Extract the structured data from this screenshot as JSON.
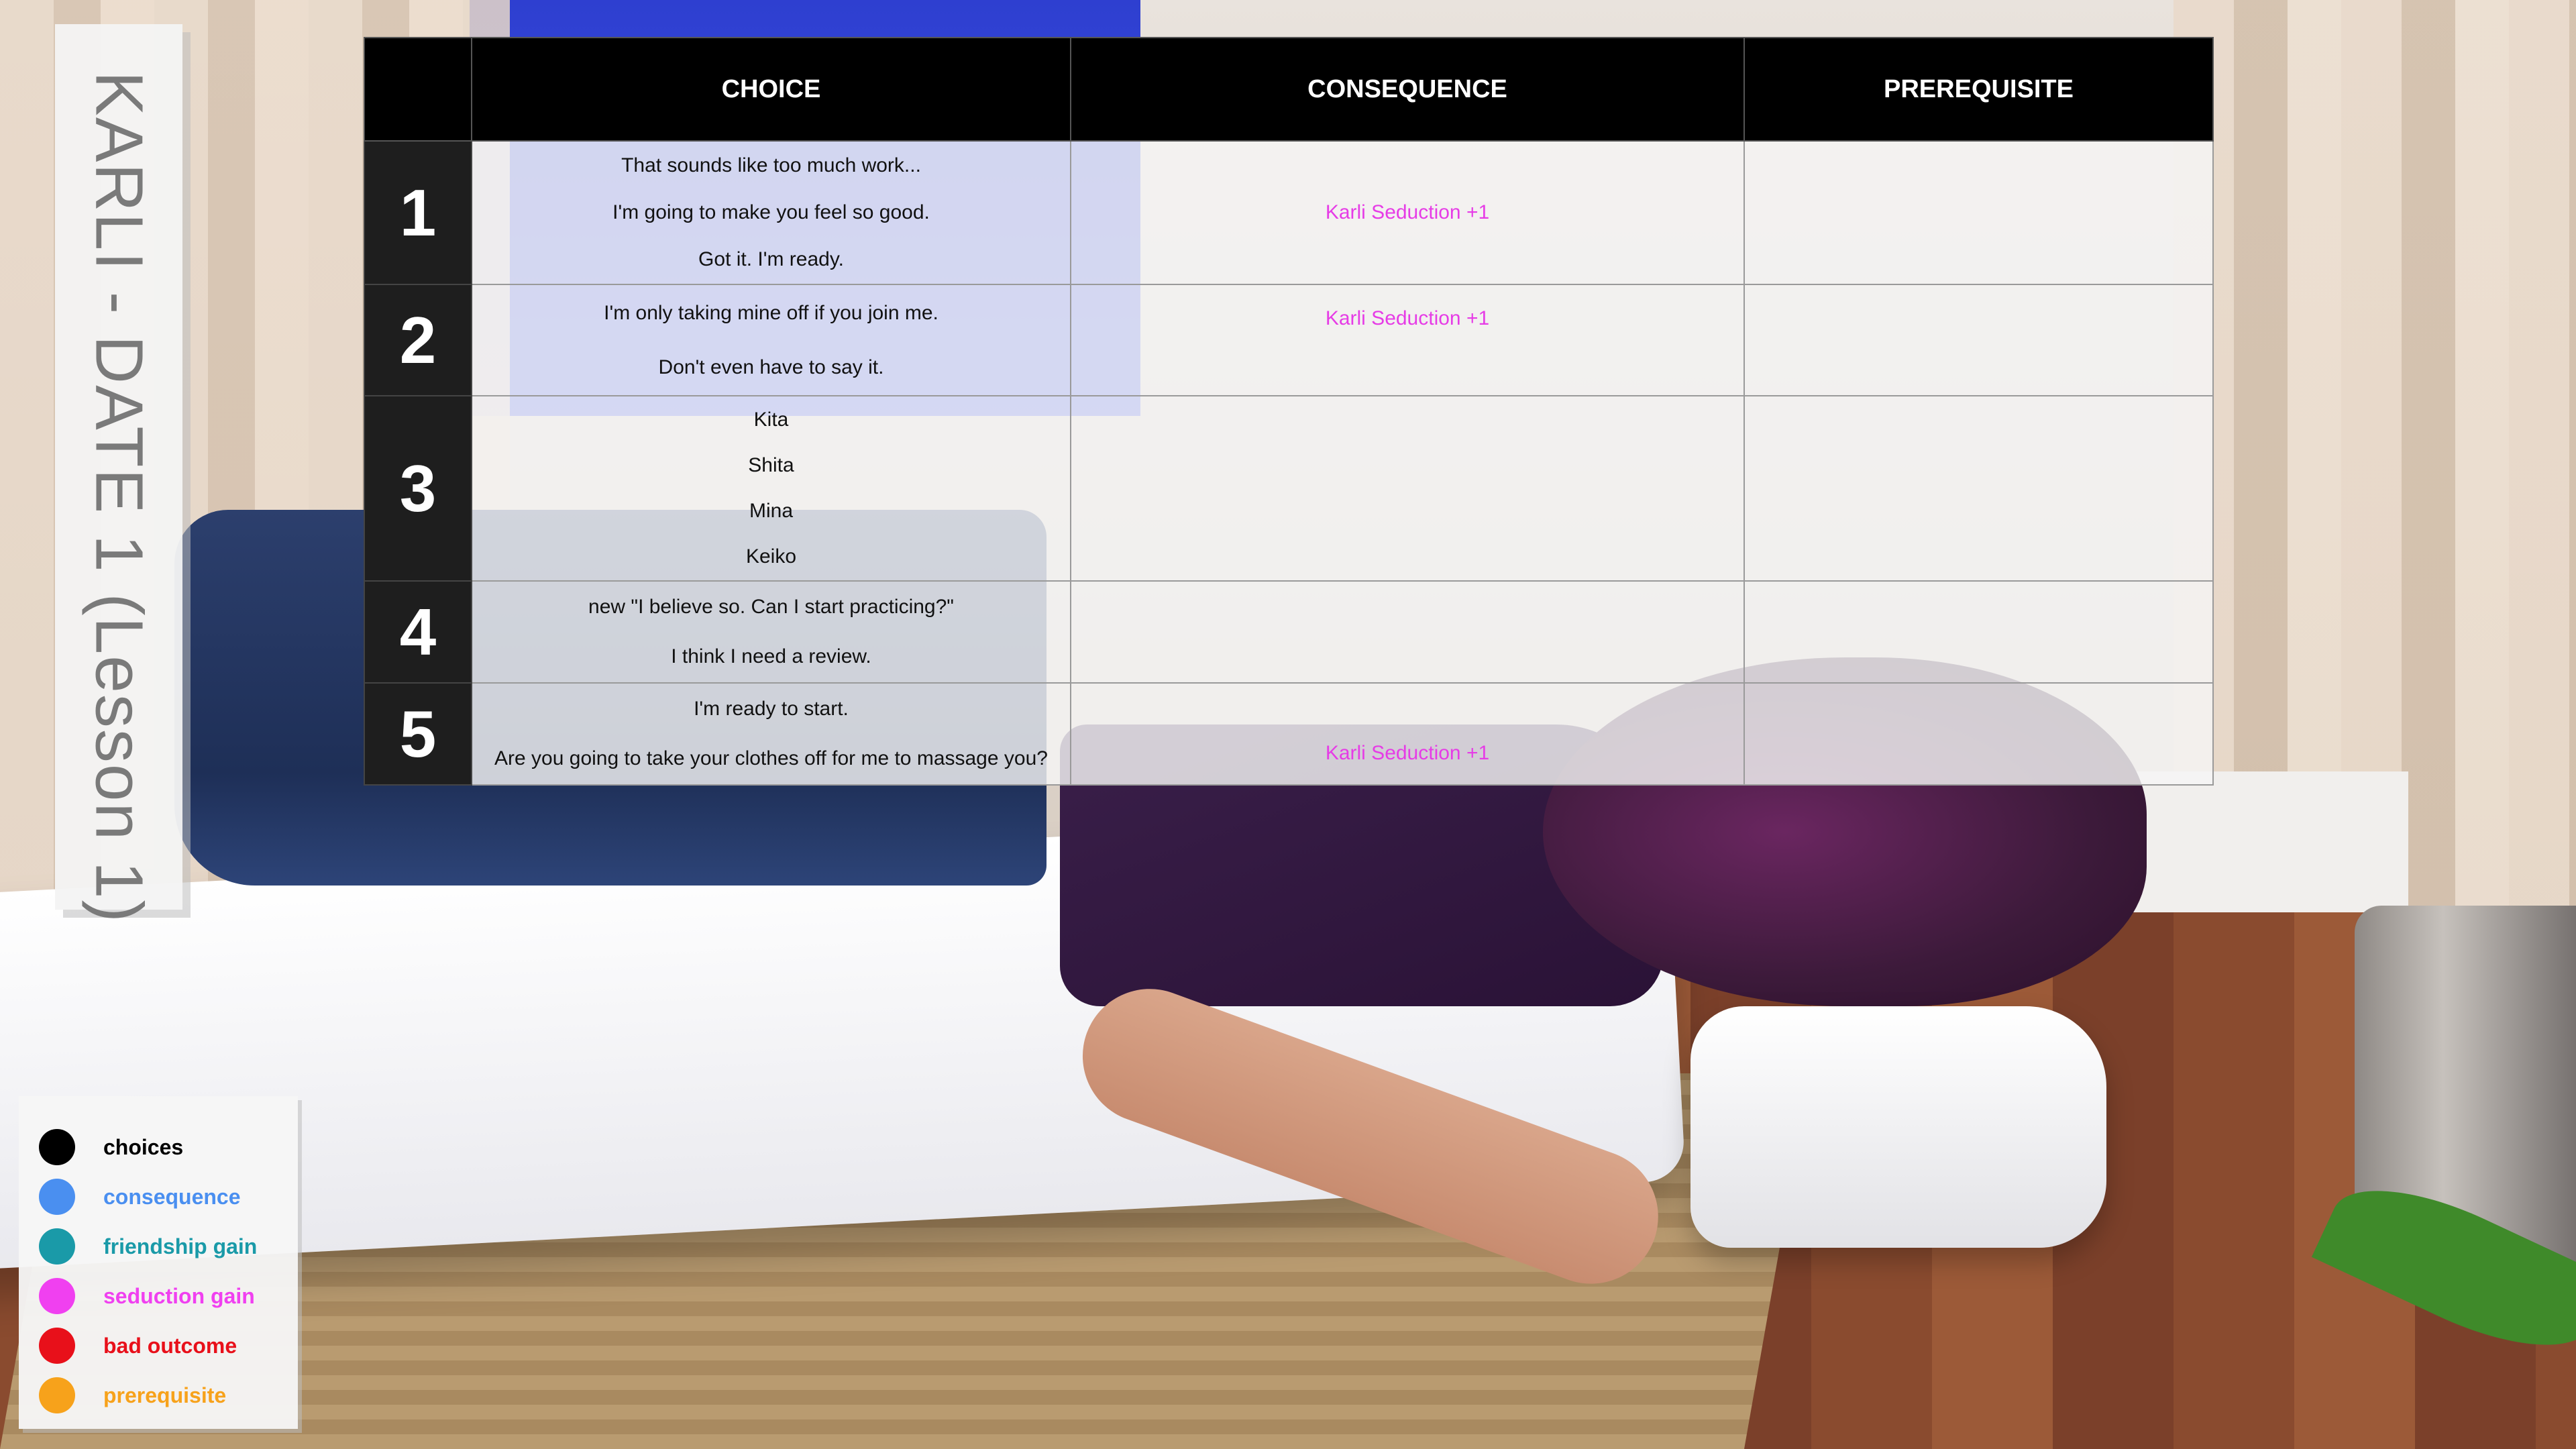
{
  "title": "KARLI - DATE 1 (Lesson 1)",
  "table": {
    "headers": {
      "choice": "CHOICE",
      "consequence": "CONSEQUENCE",
      "prerequisite": "PREREQUISITE"
    },
    "rows": [
      {
        "number": "1",
        "choices": [
          "That sounds like too much work...",
          "I'm going to make you feel so good.",
          "Got it. I'm ready."
        ],
        "consequences": [
          "",
          "Karli Seduction +1",
          ""
        ],
        "prerequisite": ""
      },
      {
        "number": "2",
        "choices": [
          "I'm only taking mine off if you join me.",
          "Don't even have to say it."
        ],
        "consequences": [
          "Karli Seduction +1",
          ""
        ],
        "prerequisite": ""
      },
      {
        "number": "3",
        "choices": [
          "Kita",
          "Shita",
          "Mina",
          "Keiko"
        ],
        "consequences": [
          "",
          "",
          "",
          ""
        ],
        "prerequisite": ""
      },
      {
        "number": "4",
        "choices": [
          "new \"I believe so. Can I start practicing?\"",
          "I think I need a review."
        ],
        "consequences": [
          "",
          ""
        ],
        "prerequisite": ""
      },
      {
        "number": "5",
        "choices": [
          "I'm ready to start.",
          "Are you going to take your clothes off for me to massage you?"
        ],
        "consequences": [
          "",
          "Karli Seduction +1"
        ],
        "prerequisite": ""
      }
    ]
  },
  "legend": [
    {
      "label": "choices",
      "color": "#000000"
    },
    {
      "label": "consequence",
      "color": "#4a8ff0"
    },
    {
      "label": "friendship gain",
      "color": "#1a9aa8"
    },
    {
      "label": "seduction gain",
      "color": "#f040f0"
    },
    {
      "label": "bad outcome",
      "color": "#e8101a"
    },
    {
      "label": "prerequisite",
      "color": "#f7a21b"
    }
  ],
  "colors": {
    "seduction_text": "#e63ce6"
  }
}
